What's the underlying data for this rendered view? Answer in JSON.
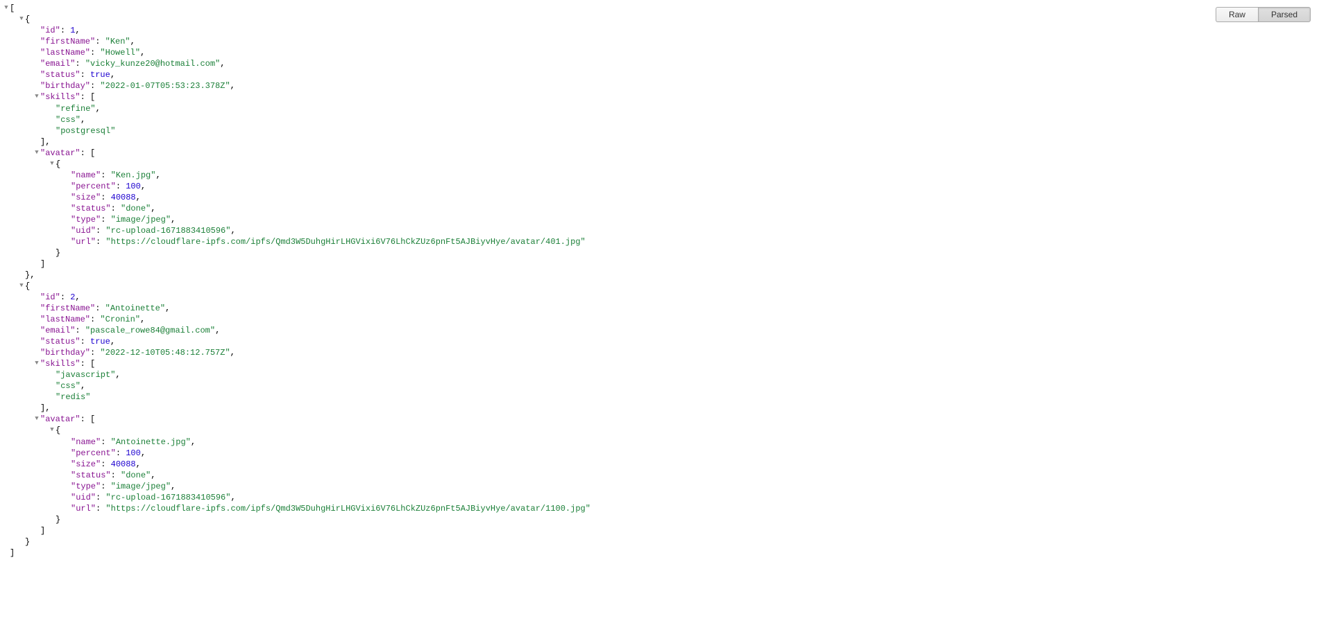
{
  "toolbar": {
    "raw": "Raw",
    "parsed": "Parsed"
  },
  "json": [
    {
      "id": 1,
      "firstName": "Ken",
      "lastName": "Howell",
      "email": "vicky_kunze20@hotmail.com",
      "status": true,
      "birthday": "2022-01-07T05:53:23.378Z",
      "skills": [
        "refine",
        "css",
        "postgresql"
      ],
      "avatar": [
        {
          "name": "Ken.jpg",
          "percent": 100,
          "size": 40088,
          "status": "done",
          "type": "image/jpeg",
          "uid": "rc-upload-1671883410596",
          "url": "https://cloudflare-ipfs.com/ipfs/Qmd3W5DuhgHirLHGVixi6V76LhCkZUz6pnFt5AJBiyvHye/avatar/401.jpg"
        }
      ]
    },
    {
      "id": 2,
      "firstName": "Antoinette",
      "lastName": "Cronin",
      "email": "pascale_rowe84@gmail.com",
      "status": true,
      "birthday": "2022-12-10T05:48:12.757Z",
      "skills": [
        "javascript",
        "css",
        "redis"
      ],
      "avatar": [
        {
          "name": "Antoinette.jpg",
          "percent": 100,
          "size": 40088,
          "status": "done",
          "type": "image/jpeg",
          "uid": "rc-upload-1671883410596",
          "url": "https://cloudflare-ipfs.com/ipfs/Qmd3W5DuhgHirLHGVixi6V76LhCkZUz6pnFt5AJBiyvHye/avatar/1100.jpg"
        }
      ]
    }
  ]
}
